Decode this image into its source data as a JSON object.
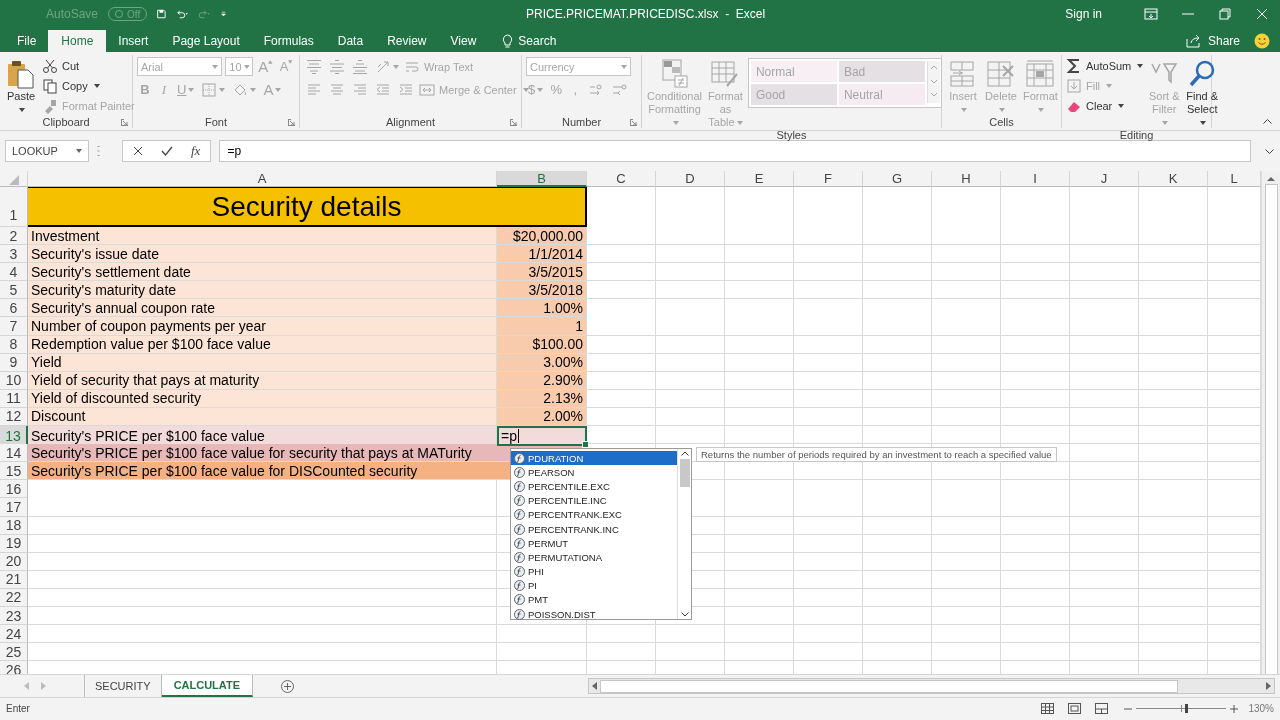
{
  "window": {
    "autosave_label": "AutoSave",
    "autosave_state": "Off",
    "title": "PRICE.PRICEMAT.PRICEDISC.xlsx  -  Excel",
    "sign_in": "Sign in"
  },
  "ribbon_tabs": [
    {
      "label": "File",
      "selected": false
    },
    {
      "label": "Home",
      "selected": true
    },
    {
      "label": "Insert",
      "selected": false
    },
    {
      "label": "Page Layout",
      "selected": false
    },
    {
      "label": "Formulas",
      "selected": false
    },
    {
      "label": "Data",
      "selected": false
    },
    {
      "label": "Review",
      "selected": false
    },
    {
      "label": "View",
      "selected": false
    }
  ],
  "tell_me": "Search",
  "share": "Share",
  "ribbon_groups": [
    {
      "label": "Clipboard",
      "kind": "columns",
      "launcher": true,
      "lines": [
        [
          {
            "kind": "large",
            "label": "Paste",
            "dropdown": true,
            "disabled": false
          }
        ],
        [
          {
            "kind": "small",
            "label": "Cut",
            "disabled": false
          },
          {
            "kind": "small",
            "label": "Copy",
            "dropdown": true,
            "disabled": false
          },
          {
            "kind": "small",
            "label": "Format Painter",
            "disabled": true
          }
        ]
      ]
    },
    {
      "label": "Font",
      "kind": "rows",
      "launcher": true,
      "lines": [
        [
          {
            "kind": "combo",
            "value": "Arial",
            "disabled": true
          },
          {
            "kind": "combo",
            "value": "10",
            "disabled": true
          },
          {
            "kind": "glyph",
            "label": "A",
            "disabled": true
          },
          {
            "kind": "glyph",
            "label": "A",
            "disabled": true
          }
        ],
        [
          {
            "kind": "glyph",
            "label": "B",
            "disabled": true
          },
          {
            "kind": "glyph",
            "label": "I",
            "disabled": true
          },
          {
            "kind": "glyph",
            "label": "U",
            "dropdown": true,
            "disabled": true
          },
          {
            "kind": "icon",
            "dropdown": true,
            "disabled": true
          },
          {
            "kind": "icon",
            "dropdown": true,
            "disabled": true
          },
          {
            "kind": "glyph",
            "label": "A",
            "dropdown": true,
            "disabled": true
          }
        ]
      ]
    },
    {
      "label": "Alignment",
      "kind": "rows",
      "launcher": true,
      "lines": [
        [
          {
            "kind": "icon",
            "disabled": true
          },
          {
            "kind": "icon",
            "disabled": true
          },
          {
            "kind": "icon",
            "disabled": true
          },
          {
            "kind": "icon",
            "dropdown": true,
            "disabled": true
          },
          {
            "kind": "small",
            "label": "Wrap Text",
            "disabled": true
          }
        ],
        [
          {
            "kind": "icon",
            "disabled": true
          },
          {
            "kind": "icon",
            "disabled": true
          },
          {
            "kind": "icon",
            "disabled": true
          },
          {
            "kind": "icon",
            "disabled": true
          },
          {
            "kind": "icon",
            "disabled": true
          },
          {
            "kind": "small",
            "label": "Merge & Center",
            "dropdown": true,
            "disabled": true
          }
        ]
      ]
    },
    {
      "label": "Number",
      "kind": "rows",
      "launcher": true,
      "lines": [
        [
          {
            "kind": "combo",
            "value": "Currency",
            "disabled": true
          }
        ],
        [
          {
            "kind": "glyph",
            "label": "$",
            "dropdown": true,
            "disabled": true
          },
          {
            "kind": "glyph",
            "label": "%",
            "disabled": true
          },
          {
            "kind": "glyph",
            "label": ",",
            "disabled": true
          },
          {
            "kind": "icon",
            "disabled": true
          },
          {
            "kind": "icon",
            "disabled": true
          }
        ]
      ]
    },
    {
      "label": "Styles",
      "kind": "columns",
      "launcher": false,
      "lines": [
        [
          {
            "kind": "large",
            "label": "Conditional Formatting",
            "dropdown": true,
            "disabled": true
          }
        ],
        [
          {
            "kind": "large",
            "label": "Format as Table",
            "dropdown": true,
            "disabled": true
          }
        ],
        [
          {
            "kind": "gallery",
            "disabled": true,
            "styles": [
              {
                "label": "Normal",
                "color": "#f7eff3"
              },
              {
                "label": "Bad",
                "color": "#e4e0e4"
              },
              {
                "label": "Good",
                "color": "#e4e0e4"
              },
              {
                "label": "Neutral",
                "color": "#f5ebf0"
              }
            ]
          }
        ]
      ]
    },
    {
      "label": "Cells",
      "kind": "columns",
      "launcher": false,
      "lines": [
        [
          {
            "kind": "large",
            "label": "Insert",
            "dropdown": true,
            "disabled": true
          }
        ],
        [
          {
            "kind": "large",
            "label": "Delete",
            "dropdown": true,
            "disabled": true
          }
        ],
        [
          {
            "kind": "large",
            "label": "Format",
            "dropdown": true,
            "disabled": true
          }
        ]
      ]
    },
    {
      "label": "Editing",
      "kind": "columns",
      "launcher": false,
      "lines": [
        [
          {
            "kind": "small",
            "label": "AutoSum",
            "dropdown": true,
            "disabled": false
          },
          {
            "kind": "small",
            "label": "Fill",
            "dropdown": true,
            "disabled": true
          },
          {
            "kind": "small",
            "label": "Clear",
            "dropdown": true,
            "disabled": false
          }
        ],
        [
          {
            "kind": "large",
            "label": "Sort & Filter",
            "dropdown": true,
            "disabled": true
          }
        ],
        [
          {
            "kind": "large",
            "label": "Find & Select",
            "dropdown": true,
            "disabled": false
          }
        ]
      ]
    }
  ],
  "name_box": "LOOKUP",
  "formula_bar": {
    "insert_function": "fx",
    "formula": "=p"
  },
  "sheet": {
    "columns": [
      {
        "label": "A",
        "selected": false
      },
      {
        "label": "B",
        "selected": true
      },
      {
        "label": "C",
        "selected": false
      },
      {
        "label": "D",
        "selected": false
      },
      {
        "label": "E",
        "selected": false
      },
      {
        "label": "F",
        "selected": false
      },
      {
        "label": "G",
        "selected": false
      },
      {
        "label": "H",
        "selected": false
      },
      {
        "label": "I",
        "selected": false
      },
      {
        "label": "J",
        "selected": false
      },
      {
        "label": "K",
        "selected": false
      },
      {
        "label": "L",
        "selected": false
      }
    ],
    "rows": [
      {
        "number": "1",
        "selected": false,
        "kind": "title",
        "cells": [
          {
            "text": "Security details",
            "color": "#f5c000"
          }
        ]
      },
      {
        "number": "2",
        "selected": false,
        "kind": "pair",
        "cells": [
          {
            "text": "Investment",
            "color": "#fce4d6"
          },
          {
            "text": "$20,000.00",
            "color": "#f8cbad"
          }
        ]
      },
      {
        "number": "3",
        "selected": false,
        "kind": "pair",
        "cells": [
          {
            "text": "Security's issue date",
            "color": "#fce4d6"
          },
          {
            "text": "1/1/2014",
            "color": "#f8cbad"
          }
        ]
      },
      {
        "number": "4",
        "selected": false,
        "kind": "pair",
        "cells": [
          {
            "text": "Security's settlement date",
            "color": "#fce4d6"
          },
          {
            "text": "3/5/2015",
            "color": "#f8cbad"
          }
        ]
      },
      {
        "number": "5",
        "selected": false,
        "kind": "pair",
        "cells": [
          {
            "text": "Security's maturity date",
            "color": "#fce4d6"
          },
          {
            "text": "3/5/2018",
            "color": "#f8cbad"
          }
        ]
      },
      {
        "number": "6",
        "selected": false,
        "kind": "pair",
        "cells": [
          {
            "text": "Security's annual coupon rate",
            "color": "#fce4d6"
          },
          {
            "text": "1.00%",
            "color": "#f8cbad"
          }
        ]
      },
      {
        "number": "7",
        "selected": false,
        "kind": "pair",
        "cells": [
          {
            "text": "Number of coupon payments per year",
            "color": "#fce4d6"
          },
          {
            "text": "1",
            "color": "#f8cbad"
          }
        ]
      },
      {
        "number": "8",
        "selected": false,
        "kind": "pair",
        "cells": [
          {
            "text": "Redemption value per $100 face value",
            "color": "#fce4d6"
          },
          {
            "text": "$100.00",
            "color": "#f8cbad"
          }
        ]
      },
      {
        "number": "9",
        "selected": false,
        "kind": "pair",
        "cells": [
          {
            "text": "Yield",
            "color": "#fce4d6"
          },
          {
            "text": "3.00%",
            "color": "#f8cbad"
          }
        ]
      },
      {
        "number": "10",
        "selected": false,
        "kind": "pair",
        "cells": [
          {
            "text": "Yield of security that pays at maturity",
            "color": "#fce4d6"
          },
          {
            "text": "2.90%",
            "color": "#f8cbad"
          }
        ]
      },
      {
        "number": "11",
        "selected": false,
        "kind": "pair",
        "cells": [
          {
            "text": "Yield of discounted security",
            "color": "#fce4d6"
          },
          {
            "text": "2.13%",
            "color": "#f8cbad"
          }
        ]
      },
      {
        "number": "12",
        "selected": false,
        "kind": "pair",
        "cells": [
          {
            "text": "Discount",
            "color": "#fce4d6"
          },
          {
            "text": "2.00%",
            "color": "#f8cbad"
          }
        ]
      },
      {
        "number": "13",
        "selected": true,
        "kind": "pair",
        "cells": [
          {
            "text": "Security's PRICE per $100 face value",
            "color": "#f2dcdb"
          },
          {
            "text": "=p",
            "color": "#f2dcdb",
            "editing": true
          }
        ]
      },
      {
        "number": "14",
        "selected": false,
        "kind": "wide",
        "cells": [
          {
            "text": "Security's PRICE per $100 face value for  security that pays at MATurity",
            "color": "#e6b8b7"
          }
        ]
      },
      {
        "number": "15",
        "selected": false,
        "kind": "wide",
        "cells": [
          {
            "text": "Security's PRICE per $100 face value for DISCounted security",
            "color": "#f4b183"
          }
        ]
      },
      {
        "number": "16",
        "selected": false,
        "kind": "empty"
      },
      {
        "number": "17",
        "selected": false,
        "kind": "empty"
      },
      {
        "number": "18",
        "selected": false,
        "kind": "empty"
      },
      {
        "number": "19",
        "selected": false,
        "kind": "empty"
      },
      {
        "number": "20",
        "selected": false,
        "kind": "empty"
      },
      {
        "number": "21",
        "selected": false,
        "kind": "empty"
      },
      {
        "number": "22",
        "selected": false,
        "kind": "empty"
      },
      {
        "number": "23",
        "selected": false,
        "kind": "empty"
      },
      {
        "number": "24",
        "selected": false,
        "kind": "empty"
      },
      {
        "number": "25",
        "selected": false,
        "kind": "empty"
      },
      {
        "number": "26",
        "selected": false,
        "kind": "empty"
      }
    ]
  },
  "autocomplete": {
    "items": [
      {
        "label": "PDURATION",
        "selected": true
      },
      {
        "label": "PEARSON",
        "selected": false
      },
      {
        "label": "PERCENTILE.EXC",
        "selected": false
      },
      {
        "label": "PERCENTILE.INC",
        "selected": false
      },
      {
        "label": "PERCENTRANK.EXC",
        "selected": false
      },
      {
        "label": "PERCENTRANK.INC",
        "selected": false
      },
      {
        "label": "PERMUT",
        "selected": false
      },
      {
        "label": "PERMUTATIONA",
        "selected": false
      },
      {
        "label": "PHI",
        "selected": false
      },
      {
        "label": "PI",
        "selected": false
      },
      {
        "label": "PMT",
        "selected": false
      },
      {
        "label": "POISSON.DIST",
        "selected": false
      }
    ],
    "tooltip": "Returns the number of periods required by an investment to reach a specified value"
  },
  "sheet_tabs": [
    {
      "label": "SECURITY",
      "selected": false
    },
    {
      "label": "CALCULATE",
      "selected": true
    }
  ],
  "status_bar": {
    "mode": "Enter",
    "zoom": {
      "level": 0.55,
      "reading": "130%"
    }
  }
}
